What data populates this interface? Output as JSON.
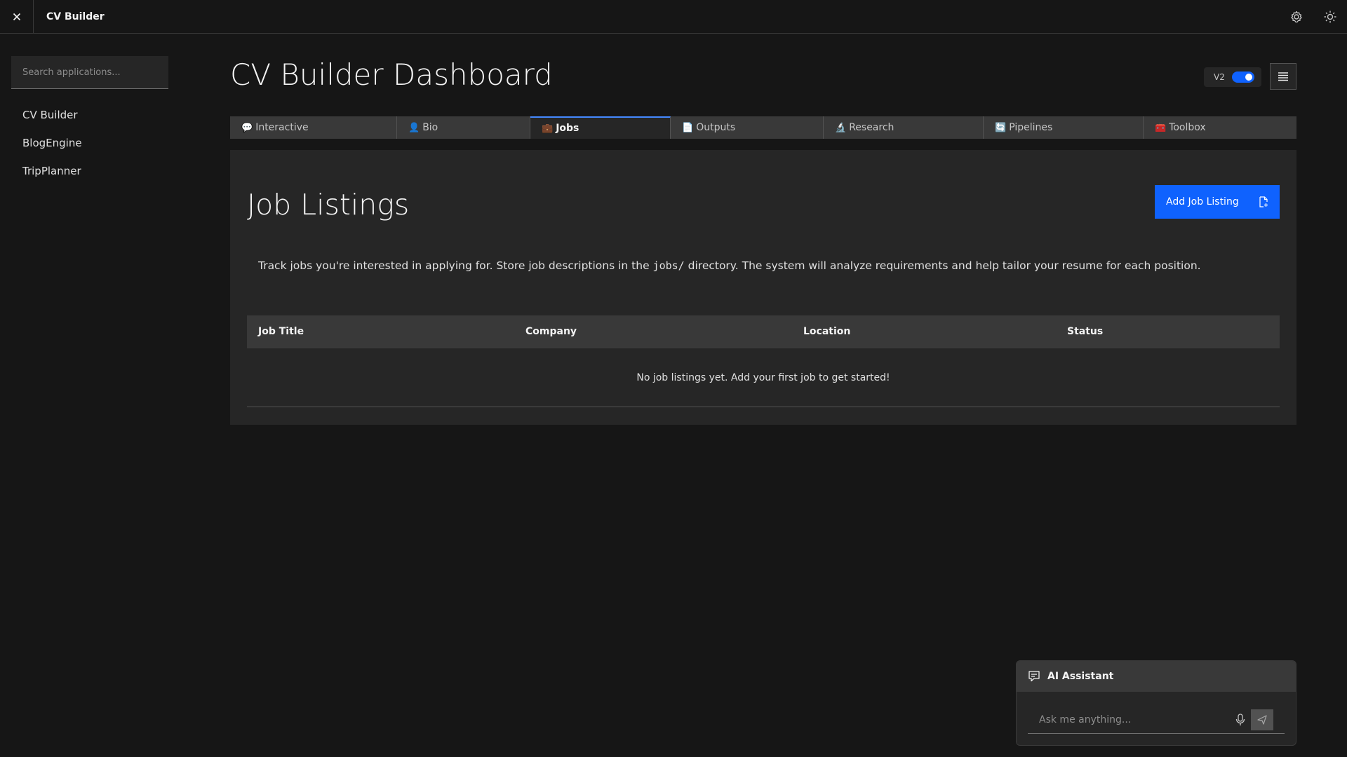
{
  "header": {
    "title": "CV Builder",
    "close_icon": "close-icon",
    "settings_icon": "gear-icon",
    "theme_icon": "sun-icon"
  },
  "sidebar": {
    "search_placeholder": "Search applications...",
    "items": [
      {
        "label": "CV Builder"
      },
      {
        "label": "BlogEngine"
      },
      {
        "label": "TripPlanner"
      }
    ]
  },
  "main": {
    "title": "CV Builder Dashboard",
    "version_label": "V2",
    "version_enabled": true,
    "tabs": [
      {
        "emoji": "💬",
        "label": "Interactive",
        "active": false
      },
      {
        "emoji": "👤",
        "label": "Bio",
        "active": false
      },
      {
        "emoji": "💼",
        "label": "Jobs",
        "active": true
      },
      {
        "emoji": "📄",
        "label": "Outputs",
        "active": false
      },
      {
        "emoji": "🔬",
        "label": "Research",
        "active": false
      },
      {
        "emoji": "🔄",
        "label": "Pipelines",
        "active": false
      },
      {
        "emoji": "🧰",
        "label": "Toolbox",
        "active": false
      }
    ]
  },
  "jobs": {
    "title": "Job Listings",
    "add_button": "Add Job Listing",
    "description_before": "Track jobs you're interested in applying for. Store job descriptions in the",
    "description_code": "jobs/",
    "description_after": "directory. The system will analyze requirements and help tailor your resume for each position.",
    "columns": [
      "Job Title",
      "Company",
      "Location",
      "Status"
    ],
    "empty_message": "No job listings yet. Add your first job to get started!"
  },
  "assistant": {
    "title": "AI Assistant",
    "placeholder": "Ask me anything...",
    "chat_icon": "chat-icon",
    "mic_icon": "microphone-icon",
    "send_icon": "send-icon"
  },
  "colors": {
    "background": "#161616",
    "surface": "#262626",
    "accent": "#0f62fe",
    "active_tab_border": "#4589ff"
  }
}
